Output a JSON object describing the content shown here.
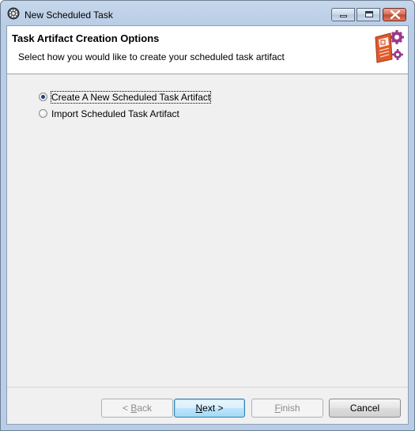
{
  "window": {
    "title": "New Scheduled Task",
    "controls": [
      "minimize-icon",
      "maximize-icon",
      "close-icon"
    ]
  },
  "banner": {
    "title": "Task Artifact Creation Options",
    "description": "Select how you would like to create your scheduled task artifact",
    "icon": "wizard-gear-icon"
  },
  "options": [
    {
      "label": "Create A New Scheduled Task Artifact",
      "selected": true
    },
    {
      "label": "Import Scheduled Task Artifact",
      "selected": false
    }
  ],
  "buttons": {
    "back": {
      "prefix": "< ",
      "mnemonic": "B",
      "rest": "ack",
      "enabled": false
    },
    "next": {
      "mnemonic": "N",
      "rest": "ext >",
      "enabled": true
    },
    "finish": {
      "mnemonic": "F",
      "rest": "inish",
      "enabled": false
    },
    "cancel": {
      "label": "Cancel",
      "enabled": true
    }
  },
  "colors": {
    "accent": "#3c7fb1",
    "banner_icon": "#e05a2b",
    "gear": "#9a3a8a"
  }
}
